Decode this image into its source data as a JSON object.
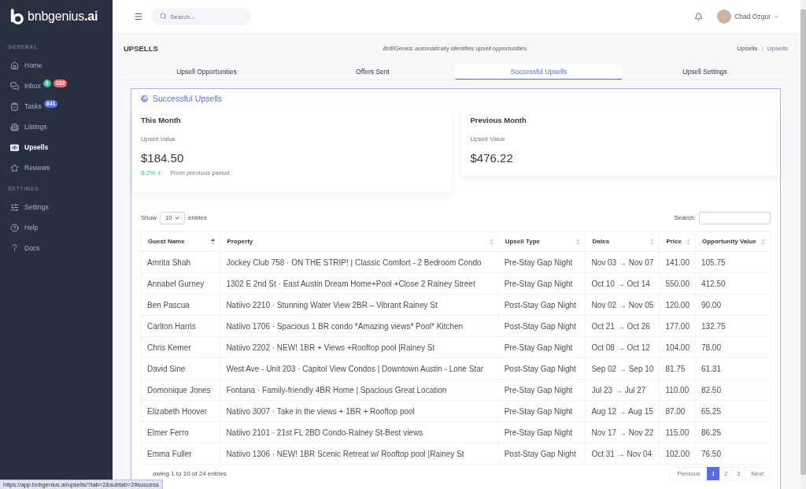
{
  "sidebar": {
    "logo": "bnbgenius**.ai**",
    "sections": [
      {
        "heading": "GENERAL",
        "items": [
          {
            "kind": "home",
            "label": "Home",
            "selected": false
          },
          {
            "kind": "inbox",
            "label": "Inbox",
            "selected": false,
            "badges": [
              {
                "text": "0",
                "color": "#34c38f"
              },
              {
                "text": "232",
                "color": "#f46a6a"
              }
            ]
          },
          {
            "kind": "tasks",
            "label": "Tasks",
            "selected": false,
            "badges": [
              {
                "text": "841",
                "color": "#556ee6"
              }
            ]
          },
          {
            "kind": "listings",
            "label": "Listings",
            "selected": false
          },
          {
            "kind": "upsells",
            "label": "Upsells",
            "selected": true
          },
          {
            "kind": "reviews",
            "label": "Reviews",
            "selected": false
          }
        ]
      },
      {
        "heading": "SETTINGS",
        "items": [
          {
            "kind": "settings",
            "label": "Settings",
            "selected": false
          },
          {
            "kind": "help",
            "label": "Help",
            "selected": false
          },
          {
            "kind": "docs",
            "label": "Docs",
            "selected": false
          }
        ]
      }
    ]
  },
  "topbar": {
    "search": {
      "placeholder": "Search..."
    },
    "user": {
      "name": "Chad Ozgur"
    }
  },
  "page_header": {
    "title": "UPSELLS",
    "subtitle": "BnBGenius automatically identifies upsell opportunities.",
    "breadcrumb": {
      "separator": "/",
      "items": [
        {
          "label": "Upsells",
          "current": false
        },
        {
          "label": "Upsells",
          "current": true
        }
      ]
    }
  },
  "tabs": [
    {
      "label": "Upsell Opportunities",
      "selected": false
    },
    {
      "label": "Offers Sent",
      "selected": false
    },
    {
      "label": "Successful Upsells",
      "selected": true
    },
    {
      "label": "Upsell Settings",
      "selected": false
    }
  ],
  "card": {
    "title": "Successful Upsells",
    "stats": [
      {
        "period": "This Month",
        "label": "Upsell Value",
        "value": "$184.50",
        "change": {
          "percent": "6.2%",
          "rising": true,
          "note": "From previous period"
        }
      },
      {
        "period": "Previous Month",
        "label": "Upsell Value",
        "value": "$476.22"
      }
    ]
  },
  "table": {
    "length": {
      "before": "Show",
      "value": "10",
      "after": "entries"
    },
    "search_label": "Search:",
    "columns": [
      {
        "label": "Guest Name",
        "sorted": true
      },
      {
        "label": "Property",
        "sorted": false
      },
      {
        "label": "Upsell Type",
        "sorted": false
      },
      {
        "label": "Dates",
        "sorted": false
      },
      {
        "label": "Price",
        "sorted": false
      },
      {
        "label": "Opportunity Value",
        "sorted": false
      }
    ],
    "rows": [
      [
        "Amrita Shah",
        "Jockey Club 758 · ON THE STRIP! | Classic Comfort - 2 Bedroom Condo",
        "Pre-Stay Gap Night",
        "Nov 03 → Nov 07",
        "141.00",
        "105.75"
      ],
      [
        "Annabel Gurney",
        "1302 E 2nd St · East Austin Dream Home+Pool +Close 2 Rainey Street",
        "Pre-Stay Gap Night",
        "Oct 10 → Oct 14",
        "550.00",
        "412.50"
      ],
      [
        "Ben Pascua",
        "Natiivo 2210 · Stunning Water View 2BR – Vibrant Rainey St",
        "Post-Stay Gap Night",
        "Nov 02 → Nov 05",
        "120.00",
        "90.00"
      ],
      [
        "Carlton Harris",
        "Natiivo 1706 · Spacious 1 BR condo *Amazing views* Pool* Kitchen",
        "Post-Stay Gap Night",
        "Oct 21 → Oct 26",
        "177.00",
        "132.75"
      ],
      [
        "Chris Kemer",
        "Natiivo 2202 · NEW! 1BR + Views +Rooftop pool |Rainey St",
        "Pre-Stay Gap Night",
        "Oct 08 → Oct 12",
        "104.00",
        "78.00"
      ],
      [
        "David Sine",
        "West Ave - Unit 203 · Capitol View Condos | Downtown Austin - Lone Star",
        "Post-Stay Gap Night",
        "Sep 02 → Sep 10",
        "81.75",
        "61.31"
      ],
      [
        "Domonique Jones",
        "Fontana · Family-friendly 4BR Home | Spacious Great Location",
        "Pre-Stay Gap Night",
        "Jul 23 → Jul 27",
        "110.00",
        "82.50"
      ],
      [
        "Elizabeth Hoover",
        "Natiivo 3007 · Take in the views + 1BR + Rooftop pool",
        "Pre-Stay Gap Night",
        "Aug 12 → Aug 15",
        "87.00",
        "65.25"
      ],
      [
        "Elmer Ferro",
        "Natiivo 2101 · 21st FL 2BD Condo-Rainey St-Best views",
        "Pre-Stay Gap Night",
        "Nov 17 → Nov 22",
        "115.00",
        "86.25"
      ],
      [
        "Emma Fuller",
        "Natiivo 1306 · NEW! 1BR Scenic Retreat w/ Rooftop pool |Rainey St",
        "Post-Stay Gap Night",
        "Oct 31 → Nov 04",
        "102.00",
        "76.50"
      ]
    ],
    "info": "owing 1 to 10 of 24 entries",
    "pagination": [
      {
        "label": "Previous",
        "selected": false
      },
      {
        "label": "1",
        "selected": true
      },
      {
        "label": "2",
        "selected": false
      },
      {
        "label": "3",
        "selected": false
      },
      {
        "label": "Next",
        "selected": false
      }
    ]
  },
  "browser_status": "https://app.bnbgenius.ai/upsells/?tab=2&subtab=2#success"
}
